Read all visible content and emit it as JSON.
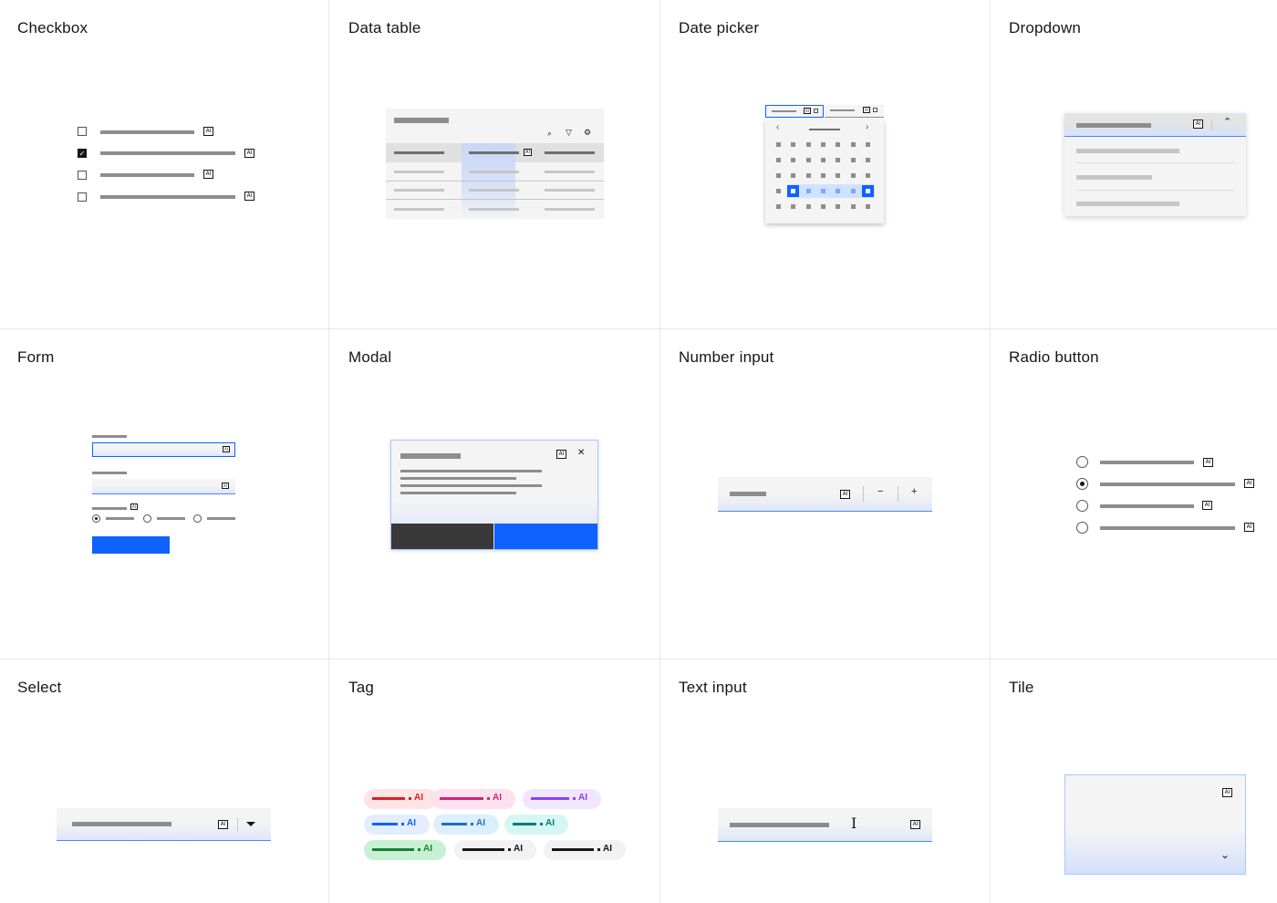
{
  "components": [
    {
      "title": "Checkbox"
    },
    {
      "title": "Data table"
    },
    {
      "title": "Date picker"
    },
    {
      "title": "Dropdown"
    },
    {
      "title": "Form"
    },
    {
      "title": "Modal"
    },
    {
      "title": "Number input"
    },
    {
      "title": "Radio button"
    },
    {
      "title": "Select"
    },
    {
      "title": "Tag"
    },
    {
      "title": "Text input"
    },
    {
      "title": "Tile"
    }
  ],
  "ai_label": "AI",
  "icons": {
    "minus": "−",
    "plus": "+",
    "close": "✕",
    "prev": "‹",
    "next": "›"
  },
  "tags": [
    {
      "color": "#da1e28",
      "bg": "#ffe3e5"
    },
    {
      "color": "#d02670",
      "bg": "#ffe0ef"
    },
    {
      "color": "#8a3ffc",
      "bg": "#f1e6ff"
    },
    {
      "color": "#0f62fe",
      "bg": "#e3edff"
    },
    {
      "color": "#1f70c1",
      "bg": "#dcefff"
    },
    {
      "color": "#007d79",
      "bg": "#d5f7f3"
    },
    {
      "color": "#198038",
      "bg": "#c8f0d2"
    },
    {
      "color": "#161616",
      "bg": "#f2f2f2"
    },
    {
      "color": "#161616",
      "bg": "#f2f2f2"
    }
  ],
  "colors": {
    "accent": "#0f62fe",
    "dark": "#393939",
    "border": "#e8e8e8"
  }
}
